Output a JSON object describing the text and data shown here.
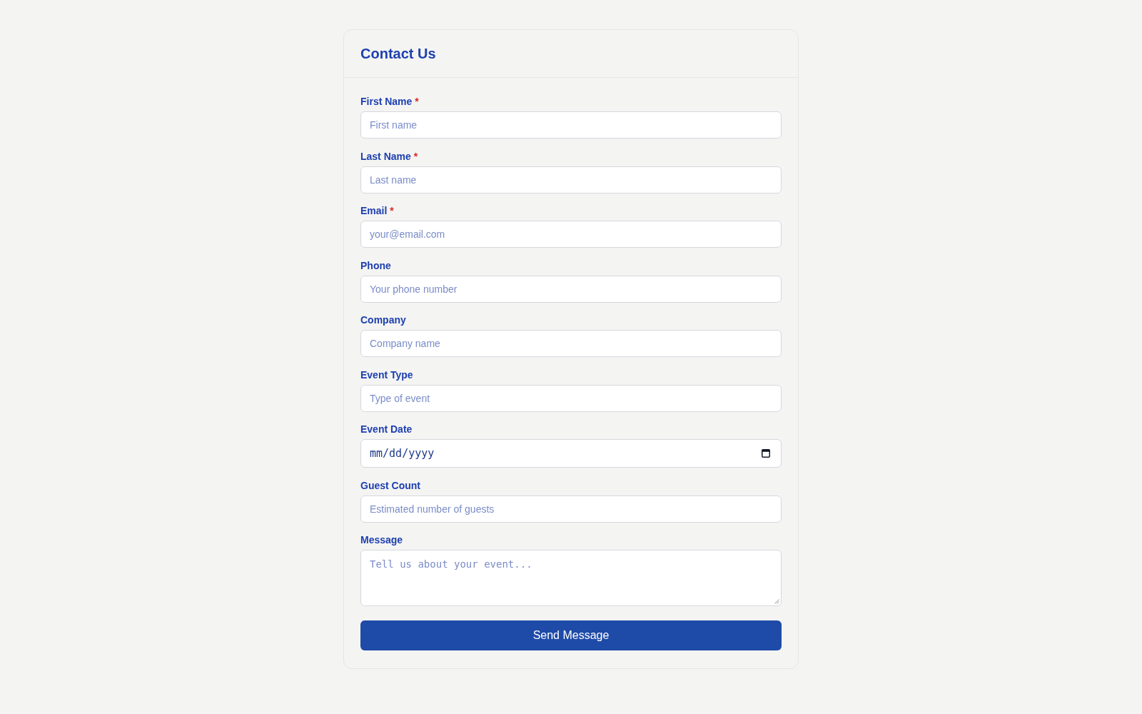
{
  "form": {
    "title": "Contact Us",
    "required_mark": "*",
    "fields": [
      {
        "kind": "text",
        "label": "First Name",
        "required": true,
        "placeholder": "First name"
      },
      {
        "kind": "text",
        "label": "Last Name",
        "required": true,
        "placeholder": "Last name"
      },
      {
        "kind": "text",
        "label": "Email",
        "required": true,
        "placeholder": "your@email.com"
      },
      {
        "kind": "text",
        "label": "Phone",
        "required": false,
        "placeholder": "Your phone number"
      },
      {
        "kind": "text",
        "label": "Company",
        "required": false,
        "placeholder": "Company name"
      },
      {
        "kind": "text",
        "label": "Event Type",
        "required": false,
        "placeholder": "Type of event"
      },
      {
        "kind": "date",
        "label": "Event Date",
        "required": false,
        "placeholder": "mm/dd/yyyy"
      },
      {
        "kind": "text",
        "label": "Guest Count",
        "required": false,
        "placeholder": "Estimated number of guests"
      },
      {
        "kind": "textarea",
        "label": "Message",
        "required": false,
        "placeholder": "Tell us about your event..."
      }
    ],
    "submit": "Send Message"
  }
}
